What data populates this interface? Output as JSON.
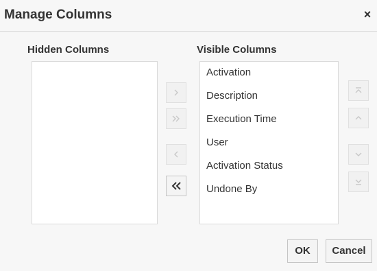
{
  "dialog": {
    "title": "Manage Columns",
    "close_symbol": "×"
  },
  "hidden_columns": {
    "header": "Hidden Columns",
    "items": []
  },
  "visible_columns": {
    "header": "Visible Columns",
    "items": [
      {
        "label": "Activation"
      },
      {
        "label": "Description"
      },
      {
        "label": "Execution Time"
      },
      {
        "label": "User"
      },
      {
        "label": "Activation Status"
      },
      {
        "label": "Undone By"
      }
    ]
  },
  "shuttle_buttons": {
    "move_right": {
      "icon": "chevron-right-icon",
      "enabled": false
    },
    "move_all_right": {
      "icon": "double-chevron-right-icon",
      "enabled": false
    },
    "move_left": {
      "icon": "chevron-left-icon",
      "enabled": false
    },
    "move_all_left": {
      "icon": "double-chevron-left-icon",
      "enabled": true
    }
  },
  "reorder_buttons": {
    "move_top": {
      "icon": "move-top-icon",
      "enabled": false
    },
    "move_up": {
      "icon": "move-up-icon",
      "enabled": false
    },
    "move_down": {
      "icon": "move-down-icon",
      "enabled": false
    },
    "move_bottom": {
      "icon": "move-bottom-icon",
      "enabled": false
    }
  },
  "footer": {
    "ok_label": "OK",
    "cancel_label": "Cancel"
  },
  "colors": {
    "enabled_glyph": "#333333",
    "disabled_glyph": "#c8c8c8",
    "list_background": "#ffffff",
    "dialog_background": "#f7f7f7"
  }
}
